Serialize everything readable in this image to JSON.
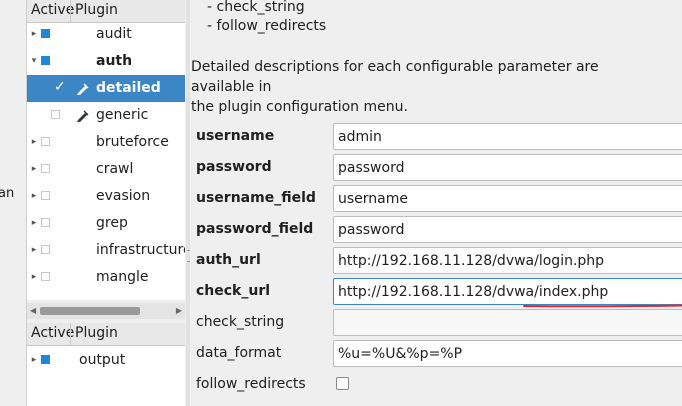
{
  "left_strip": {
    "fragment": "an"
  },
  "plugin_tree": {
    "headers": {
      "active": "Active",
      "plugin": "Plugin"
    },
    "rows": [
      {
        "label": "audit",
        "toggle": "▸",
        "active": true,
        "bold": false
      },
      {
        "label": "auth",
        "toggle": "▾",
        "active": true,
        "bold": true
      },
      {
        "label": "detailed",
        "toggle": "",
        "active": true,
        "bold": true,
        "selected": true,
        "child": true,
        "has_icon": true,
        "icon": "pencil-icon"
      },
      {
        "label": "generic",
        "toggle": "",
        "active": false,
        "bold": false,
        "child": true,
        "has_icon": true,
        "icon": "pencil-icon"
      },
      {
        "label": "bruteforce",
        "toggle": "▸",
        "active": false,
        "bold": false
      },
      {
        "label": "crawl",
        "toggle": "▸",
        "active": false,
        "bold": false
      },
      {
        "label": "evasion",
        "toggle": "▸",
        "active": false,
        "bold": false
      },
      {
        "label": "grep",
        "toggle": "▸",
        "active": false,
        "bold": false
      },
      {
        "label": "infrastructure",
        "toggle": "▸",
        "active": false,
        "bold": false
      },
      {
        "label": "mangle",
        "toggle": "▸",
        "active": false,
        "bold": false
      }
    ]
  },
  "output_tree": {
    "headers": {
      "active": "Active",
      "plugin": "Plugin"
    },
    "rows": [
      {
        "label": "output",
        "toggle": "▸",
        "active": true
      }
    ]
  },
  "config": {
    "bullets": [
      "- check_string",
      "- follow_redirects"
    ],
    "description_line1": "Detailed descriptions for each configurable parameter are available in",
    "description_line2": "the plugin configuration menu.",
    "fields": [
      {
        "label": "username",
        "value": "admin",
        "bold": true
      },
      {
        "label": "password",
        "value": "password",
        "bold": true
      },
      {
        "label": "username_field",
        "value": "username",
        "bold": true
      },
      {
        "label": "password_field",
        "value": "password",
        "bold": true
      },
      {
        "label": "auth_url",
        "value": "http://192.168.11.128/dvwa/login.php",
        "bold": true
      },
      {
        "label": "check_url",
        "value": "http://192.168.11.128/dvwa/index.php",
        "bold": true,
        "focused": true
      },
      {
        "label": "check_string",
        "value": "",
        "bold": false
      },
      {
        "label": "data_format",
        "value": "%u=%U&%p=%P",
        "bold": false
      }
    ],
    "follow_redirects": {
      "label": "follow_redirects",
      "checked": false
    }
  },
  "colors": {
    "selection": "#3d86c6",
    "active_checkbox": "#1f87d6",
    "annotation": "#e0282f"
  }
}
